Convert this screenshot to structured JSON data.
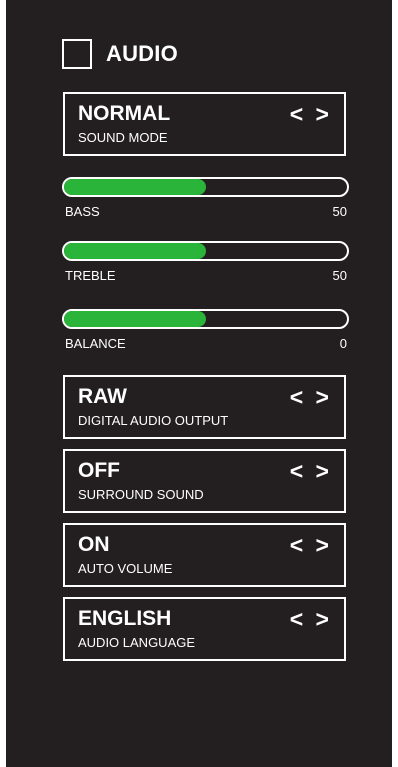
{
  "header": {
    "title": "AUDIO"
  },
  "options": {
    "sound_mode": {
      "value": "NORMAL",
      "label": "SOUND MODE",
      "arrows": "< >"
    },
    "digital_audio_output": {
      "value": "RAW",
      "label": "DIGITAL AUDIO OUTPUT",
      "arrows": "< >"
    },
    "surround_sound": {
      "value": "OFF",
      "label": "SURROUND SOUND",
      "arrows": "< >"
    },
    "auto_volume": {
      "value": "ON",
      "label": "AUTO VOLUME",
      "arrows": "< >"
    },
    "audio_language": {
      "value": "ENGLISH",
      "label": "AUDIO LANGUAGE",
      "arrows": "< >"
    }
  },
  "sliders": {
    "bass": {
      "label": "BASS",
      "value": "50",
      "fill_fraction": 0.5
    },
    "treble": {
      "label": "TREBLE",
      "value": "50",
      "fill_fraction": 0.5
    },
    "balance": {
      "label": "BALANCE",
      "value": "0",
      "fill_fraction": 0.5
    }
  },
  "colors": {
    "background": "#231f20",
    "slider_fill": "#2ab43a",
    "foreground": "#ffffff"
  }
}
